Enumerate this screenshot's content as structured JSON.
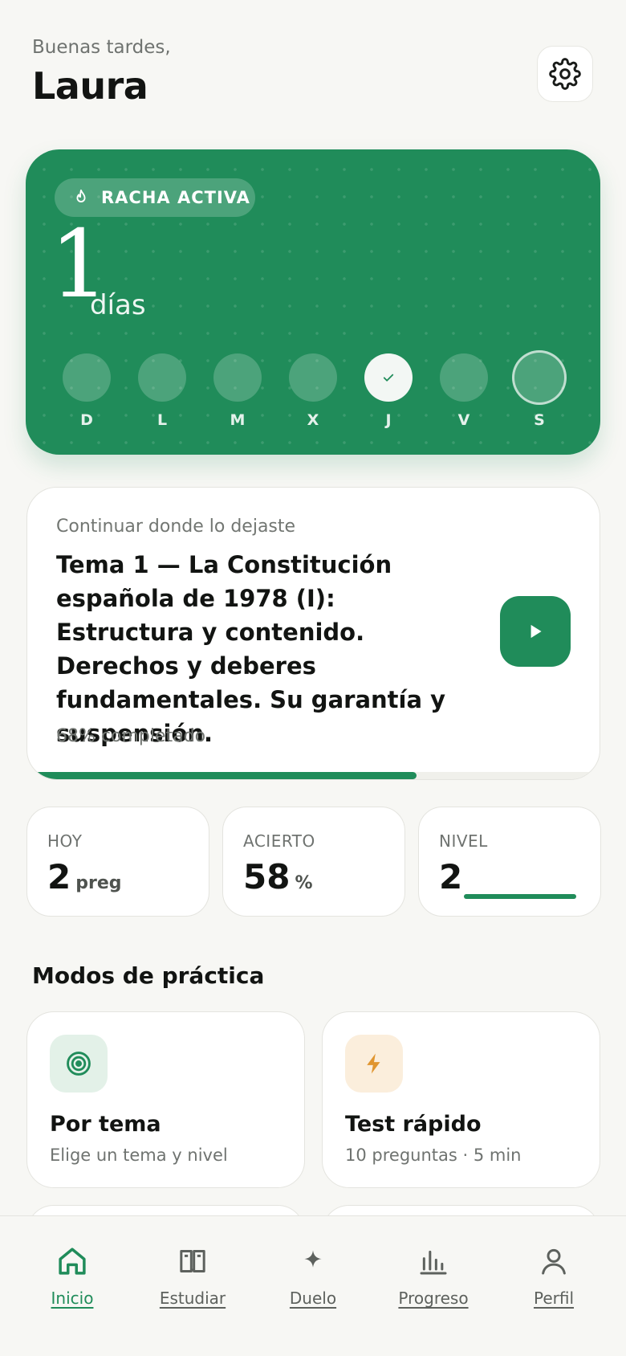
{
  "header": {
    "greeting": "Buenas tardes,",
    "user_name": "Laura",
    "settings_icon": "gear-icon"
  },
  "streak": {
    "badge_icon": "flame-icon",
    "badge_label": "RACHA ACTIVA",
    "count": "1",
    "unit": "días",
    "days": [
      {
        "label": "D",
        "state": "empty"
      },
      {
        "label": "L",
        "state": "empty"
      },
      {
        "label": "M",
        "state": "empty"
      },
      {
        "label": "X",
        "state": "empty"
      },
      {
        "label": "J",
        "state": "done"
      },
      {
        "label": "V",
        "state": "empty"
      },
      {
        "label": "S",
        "state": "today"
      }
    ],
    "colors": {
      "card": "#208c5a"
    }
  },
  "continue_card": {
    "kicker": "Continuar donde lo dejaste",
    "title": "Tema 1 — La Constitución española de 1978 (I): Estructura y contenido. Derechos y deberes fundamentales. Su garantía y suspensión.",
    "progress_text": "68% completado",
    "progress_percent": 68,
    "play_icon": "play-icon"
  },
  "stats": [
    {
      "label": "HOY",
      "value": "2",
      "unit": "preg"
    },
    {
      "label": "ACIERTO",
      "value": "58",
      "unit": "%"
    },
    {
      "label": "NIVEL",
      "value": "2",
      "level_progress": 1.0
    }
  ],
  "practice_modes": {
    "title": "Modos de práctica",
    "items": [
      {
        "icon": "target-icon",
        "title": "Por tema",
        "subtitle": "Elige un tema y nivel",
        "icon_bg": "#e3f1e8",
        "icon_color": "#208c5a"
      },
      {
        "icon": "lightning-icon",
        "title": "Test rápido",
        "subtitle": "10 preguntas · 5 min",
        "icon_bg": "#fbeedc",
        "icon_color": "#e0952f"
      }
    ]
  },
  "bottom_nav": {
    "items": [
      {
        "label": "Inicio",
        "icon": "home-icon",
        "active": true
      },
      {
        "label": "Estudiar",
        "icon": "book-icon",
        "active": false
      },
      {
        "label": "Duelo",
        "icon": "sparkle-icon",
        "active": false
      },
      {
        "label": "Progreso",
        "icon": "bar-chart-icon",
        "active": false
      },
      {
        "label": "Perfil",
        "icon": "user-icon",
        "active": false
      }
    ]
  },
  "accent_color": "#208c5a"
}
